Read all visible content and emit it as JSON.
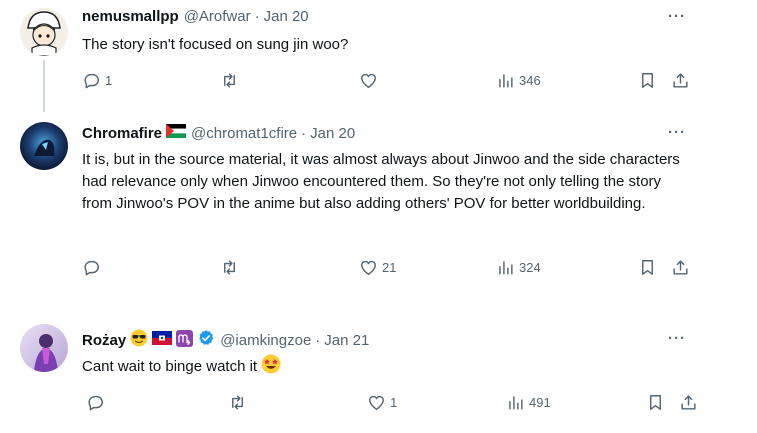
{
  "tweets": [
    {
      "name": "nemusmallpp",
      "handle": "@Arofwar",
      "separator": "·",
      "date": "Jan 20",
      "text": "The story isn't focused on sung jin woo?",
      "reply_count": "1",
      "retweet_count": "",
      "like_count": "",
      "views": "346",
      "more": "···"
    },
    {
      "name": "Chromafire",
      "handle": "@chromat1cfire",
      "separator": "·",
      "date": "Jan 20",
      "text": "It is, but in the source material, it was almost always about Jinwoo and the side characters had relevance only when Jinwoo encountered them. So they're not only telling the story from Jinwoo's POV in the anime but also adding others' POV for better worldbuilding.",
      "reply_count": "",
      "retweet_count": "",
      "like_count": "21",
      "views": "324",
      "more": "···"
    },
    {
      "name": "Rożay",
      "handle": "@iamkingzoe",
      "separator": "·",
      "date": "Jan 21",
      "text": "Cant wait to binge watch it",
      "reply_count": "",
      "retweet_count": "",
      "like_count": "1",
      "views": "491",
      "more": "···"
    }
  ],
  "icons": [
    "reply-icon",
    "retweet-icon",
    "like-icon",
    "views-icon",
    "bookmark-icon",
    "share-icon"
  ],
  "colors": {
    "text": "#0f1419",
    "secondary": "#536471",
    "verified": "#1d9bf0"
  }
}
